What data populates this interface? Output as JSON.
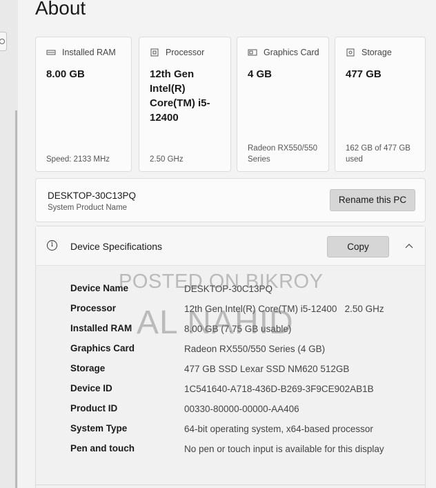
{
  "page": {
    "title": "About"
  },
  "cards": [
    {
      "label": "Installed RAM",
      "value": "8.00 GB",
      "sub": "Speed: 2133 MHz",
      "icon": "ram-icon"
    },
    {
      "label": "Processor",
      "value": "12th Gen Intel(R) Core(TM) i5-12400",
      "sub": "2.50 GHz",
      "icon": "processor-icon"
    },
    {
      "label": "Graphics Card",
      "value": "4 GB",
      "sub": "Radeon RX550/550 Series",
      "icon": "graphics-card-icon"
    },
    {
      "label": "Storage",
      "value": "477 GB",
      "sub": "162 GB of 477 GB used",
      "icon": "storage-icon"
    }
  ],
  "device_name": {
    "name": "DESKTOP-30C13PQ",
    "subtitle": "System Product Name",
    "rename_label": "Rename this PC"
  },
  "specs": {
    "title": "Device Specifications",
    "copy_label": "Copy",
    "rows": [
      {
        "label": "Device Name",
        "value": "DESKTOP-30C13PQ"
      },
      {
        "label": "Processor",
        "value": "12th Gen Intel(R) Core(TM) i5-12400   2.50 GHz"
      },
      {
        "label": "Installed RAM",
        "value": "8.00 GB (7.75 GB usable)"
      },
      {
        "label": "Graphics Card",
        "value": "Radeon RX550/550 Series (4 GB)"
      },
      {
        "label": "Storage",
        "value": "477 GB SSD Lexar SSD NM620 512GB"
      },
      {
        "label": "Device ID",
        "value": "1C541640-A718-436D-B269-3F9CE902AB1B"
      },
      {
        "label": "Product ID",
        "value": "00330-80000-00000-AA406"
      },
      {
        "label": "System Type",
        "value": "64-bit operating system, x64-based processor"
      },
      {
        "label": "Pen and touch",
        "value": "No pen or touch input is available for this display"
      }
    ]
  },
  "watermark": {
    "line1": "POSTED ON BIKROY",
    "line2": "AL NAHID"
  },
  "colors": {
    "background": "#f3f3f3",
    "card": "#fbfbfb",
    "button": "#d6d6d6"
  }
}
